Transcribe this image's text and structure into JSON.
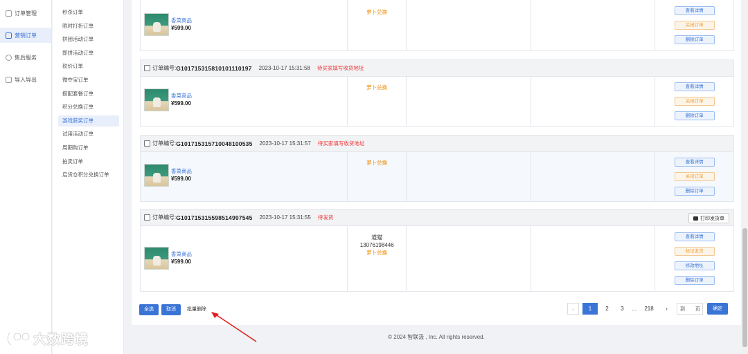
{
  "sidebar_main": [
    {
      "label": "订单管理",
      "active": false
    },
    {
      "label": "营销订单",
      "active": true
    },
    {
      "label": "售后服务",
      "active": false
    },
    {
      "label": "导入导出",
      "active": false
    }
  ],
  "sidebar_sub": [
    {
      "label": "秒杀订单"
    },
    {
      "label": "限时打折订单"
    },
    {
      "label": "拼团活动订单"
    },
    {
      "label": "即拼活动订单"
    },
    {
      "label": "砍价订单"
    },
    {
      "label": "微夺宝订单"
    },
    {
      "label": "搭配套餐订单"
    },
    {
      "label": "积分兑换订单"
    },
    {
      "label": "游戏获奖订单"
    },
    {
      "label": "试用活动订单"
    },
    {
      "label": "周期购订单"
    },
    {
      "label": "拍卖订单"
    },
    {
      "label": "启货仓积分兑换订单"
    }
  ],
  "orders": [
    {
      "no_label": "",
      "no": "",
      "time": "",
      "status": "",
      "product_name": "香菜商品",
      "price": "¥599.00",
      "buyer_name": "",
      "buyer_phone": "",
      "payment": "萝卜兑换",
      "actions": [
        "查看详情",
        "关闭订单",
        "删除订单"
      ]
    },
    {
      "no_label": "订单编号:",
      "no": "G1017153158101011101​97",
      "time": "2023-10-17 15:31:58",
      "status": "待买家填写收货地址",
      "product_name": "香菜商品",
      "price": "¥599.00",
      "buyer_name": "",
      "buyer_phone": "",
      "payment": "萝卜兑换",
      "actions": [
        "查看详情",
        "关闭订单",
        "删除订单"
      ]
    },
    {
      "no_label": "订单编号:",
      "no": "G101715315710048100535",
      "time": "2023-10-17 15:31:57",
      "status": "待买家填写收货地址",
      "product_name": "香菜商品",
      "price": "¥599.00",
      "buyer_name": "",
      "buyer_phone": "",
      "payment": "萝卜兑换",
      "actions": [
        "查看详情",
        "关闭订单",
        "删除订单"
      ]
    },
    {
      "no_label": "订单编号:",
      "no": "G101715315598514997545",
      "time": "2023-10-17 15:31:55",
      "status": "待发货",
      "print_label": "打印发货单",
      "product_name": "香菜商品",
      "price": "¥599.00",
      "buyer_name": "道猫",
      "buyer_phone": "13076198446",
      "payment": "萝卜兑换",
      "actions": [
        "查看详情",
        "标记发货",
        "修改地址",
        "删除订单"
      ]
    }
  ],
  "bulk": {
    "select_all": "全选",
    "cancel": "取消",
    "batch_delete": "批量删除"
  },
  "pagination": {
    "prev": "‹",
    "pages": [
      "1",
      "2",
      "3"
    ],
    "ellipsis": "...",
    "last": "218",
    "next": "›",
    "goto_label": "到",
    "page_unit": "页",
    "confirm": "确定"
  },
  "footer": "© 2024 智联汲 , Inc. All rights reserved.",
  "watermark": "大数跨境",
  "colors": {
    "primary": "#3a74d6",
    "status_red": "#e33333",
    "payment_orange": "#f08a00",
    "arrow_red": "#e02020"
  }
}
